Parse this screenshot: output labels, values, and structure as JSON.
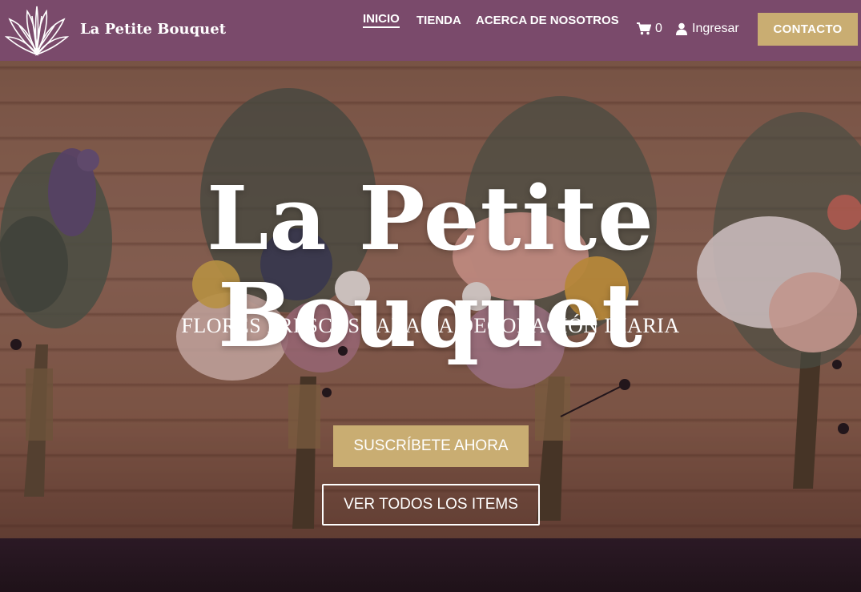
{
  "brand": {
    "name": "La Petite Bouquet",
    "logo_icon": "protea-flower-logo-icon"
  },
  "nav": {
    "links": [
      {
        "label": "INICIO",
        "active": true
      },
      {
        "label": "TIENDA",
        "active": false
      },
      {
        "label": "ACERCA DE NOSOTROS",
        "active": false
      }
    ],
    "cart": {
      "icon": "cart-icon",
      "count": "0"
    },
    "login": {
      "icon": "user-icon",
      "label": "Ingresar"
    },
    "contact_label": "CONTACTO"
  },
  "hero": {
    "title": "La Petite Bouquet",
    "subtitle": "FLORES FRESCAS PARA LA DECORACIÓN DIARIA",
    "primary_button": "SUSCRÍBETE AHORA",
    "secondary_button": "VER TODOS LOS ITEMS"
  },
  "colors": {
    "nav_background": "#7a4a6b",
    "accent_gold": "#c9ad72",
    "text_white": "#ffffff"
  }
}
